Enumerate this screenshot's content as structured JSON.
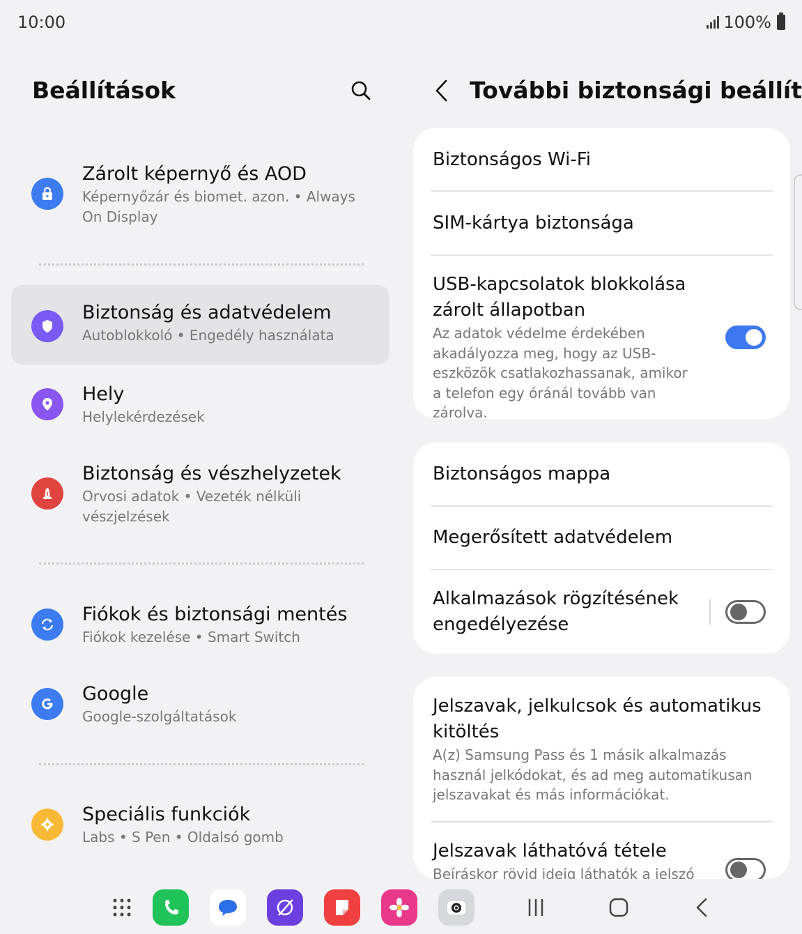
{
  "status": {
    "time": "10:00",
    "battery": "100%"
  },
  "left": {
    "title": "Beállítások",
    "items": [
      {
        "title": "Zárolt képernyő és AOD",
        "subtitle": "Képernyőzár és biomet. azon.  •  Always On Display",
        "icon": "lock-icon",
        "color": "#3d7cf0"
      },
      {
        "title": "Biztonság és adatvédelem",
        "subtitle": "Autoblokkoló  •  Engedély használata",
        "icon": "shield-icon",
        "color": "#7a5af5"
      },
      {
        "title": "Hely",
        "subtitle": "Helylekérdezések",
        "icon": "location-pin-icon",
        "color": "#8a56f0"
      },
      {
        "title": "Biztonság és vészhelyzetek",
        "subtitle": "Orvosi adatok  •  Vezeték nélküli vészjelzések",
        "icon": "emergency-icon",
        "color": "#e0443e"
      },
      {
        "title": "Fiókok és biztonsági mentés",
        "subtitle": "Fiókok kezelése  •  Smart Switch",
        "icon": "sync-icon",
        "color": "#3d7cf0"
      },
      {
        "title": "Google",
        "subtitle": "Google-szolgáltatások",
        "icon": "google-icon",
        "color": "#3d7cf0"
      },
      {
        "title": "Speciális funkciók",
        "subtitle": "Labs  •  S Pen  •  Oldalsó gomb",
        "icon": "advanced-features-icon",
        "color": "#f7b936"
      }
    ]
  },
  "right": {
    "title": "További biztonsági beállít...",
    "card1": {
      "wifi": "Biztonságos Wi-Fi",
      "sim": "SIM-kártya biztonsága",
      "usb_title": "USB-kapcsolatok blokkolása zárolt állapotban",
      "usb_sub": "Az adatok védelme érdekében akadályozza meg, hogy az USB-eszközök csatlakozhassanak, amikor a telefon egy óránál tovább van zárolva.",
      "usb_toggle": true
    },
    "card2": {
      "folder": "Biztonságos mappa",
      "privacy": "Megerősített adatvédelem",
      "pin_title": "Alkalmazások rögzítésének engedélyezése",
      "pin_toggle": false
    },
    "card3": {
      "passwords_title": "Jelszavak, jelkulcsok és automatikus kitöltés",
      "passwords_sub": "A(z) Samsung Pass és 1 másik alkalmazás használ jelkódokat, és ad meg automatikusan jelszavakat és más információkat.",
      "show_title": "Jelszavak láthatóvá tétele",
      "show_sub": "Beíráskor rövid ideig láthatók a jelszó",
      "show_toggle": false
    }
  },
  "accent": "#3d78f0",
  "navbar": {
    "apps": [
      "apps-grid-icon",
      "phone-app-icon",
      "messages-app-icon",
      "internet-app-icon",
      "notes-app-icon",
      "gallery-app-icon",
      "camera-app-icon"
    ],
    "keys": [
      "recents-icon",
      "home-icon",
      "back-icon"
    ]
  }
}
